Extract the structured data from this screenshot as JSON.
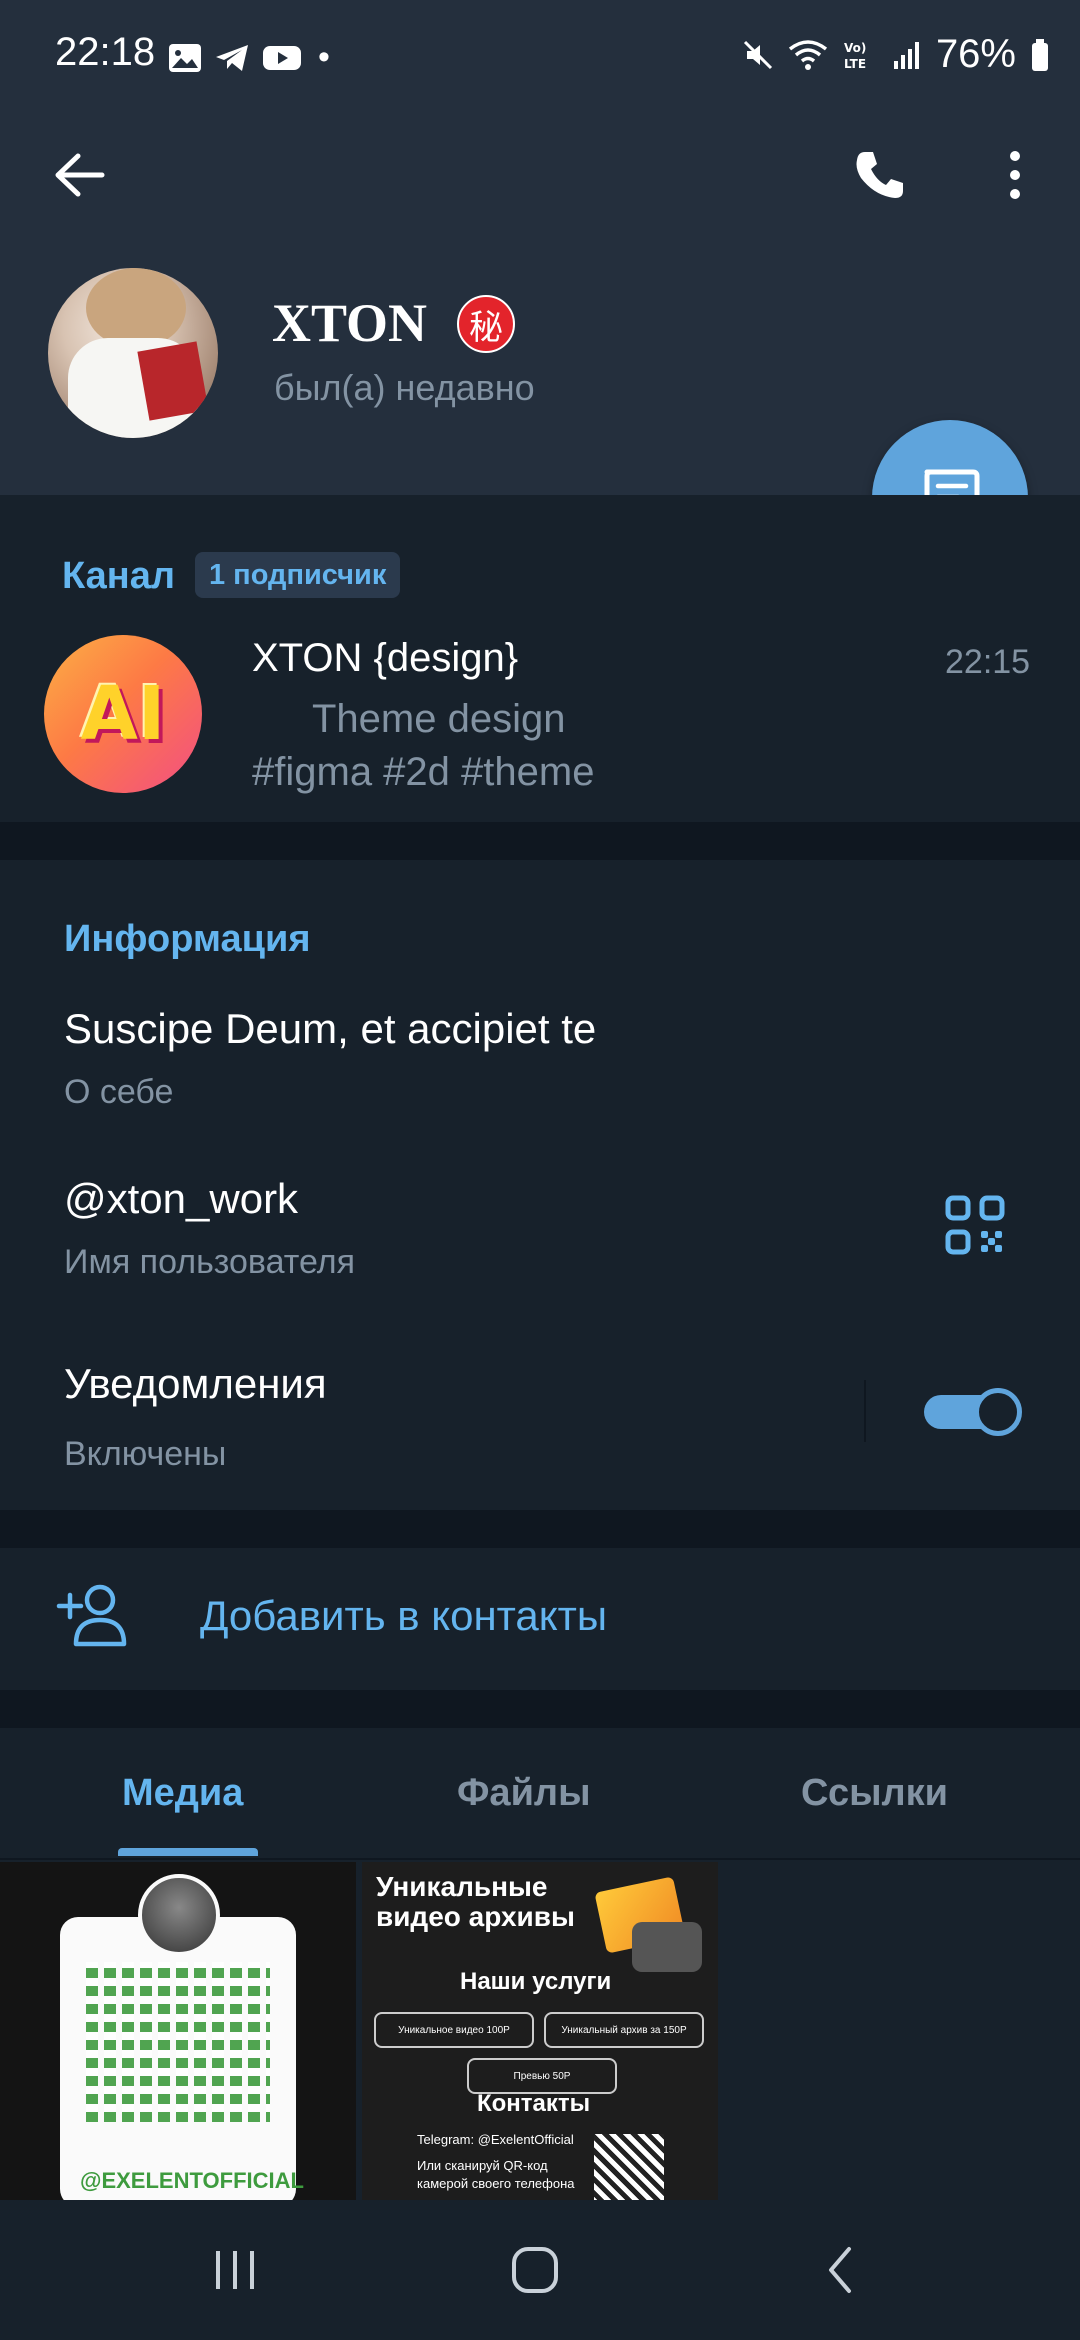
{
  "status_bar": {
    "time": "22:18",
    "dot": "•",
    "battery": "76%",
    "left_icons": [
      "gallery-icon",
      "telegram-icon",
      "youtube-icon"
    ],
    "right_icons": [
      "mute-icon",
      "wifi-icon",
      "volte-icon",
      "signal-icon",
      "battery-icon"
    ]
  },
  "header": {
    "name": "XTON",
    "badge_glyph": "秘",
    "status": "был(а) недавно"
  },
  "channel": {
    "label": "Канал",
    "subscribers": "1 подписчик",
    "avatar_text": "AI",
    "title": "XTON {design}",
    "time": "22:15",
    "line1": "Theme design",
    "line2": "#figma #2d #theme"
  },
  "info": {
    "heading": "Информация",
    "bio": "Suscipe Deum, et accipiet te",
    "bio_label": "О себе",
    "username": "@xton_work",
    "username_label": "Имя пользователя",
    "notifications_label": "Уведомления",
    "notifications_value": "Включены",
    "notifications_on": true
  },
  "add_contact": {
    "label": "Добавить в контакты"
  },
  "tabs": {
    "items": [
      "Медиа",
      "Файлы",
      "Ссылки"
    ],
    "active": "Медиа"
  },
  "media": {
    "thumb1_handle": "@EXELENTOFFICIAL",
    "thumb2_title": "Уникальные видео архивы",
    "thumb2_services": "Наши услуги",
    "thumb2_pill1": "Уникальное видео 100Р",
    "thumb2_pill2": "Уникальный архив за 150Р",
    "thumb2_pill3": "Превью 50Р",
    "thumb2_contacts": "Контакты",
    "thumb2_telegram": "Telegram: @ExelentOfficial",
    "thumb2_scan": "Или сканируй QR-код камерой своего телефона"
  },
  "colors": {
    "accent": "#64b5ef",
    "header_bg": "#242f3d",
    "page_bg": "#17212b",
    "muted_text": "#8393a3",
    "fab": "#5fa4dc"
  }
}
